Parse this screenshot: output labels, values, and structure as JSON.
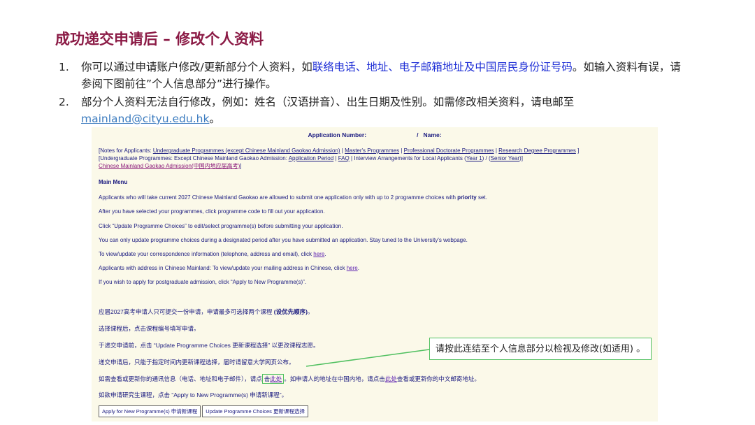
{
  "title": "成功递交申请后 – 修改个人资料",
  "points": [
    {
      "num": "1.",
      "pre": "你可以通过申请账户修改/更新部分个人资料，如",
      "hl1": "联络电话",
      "sep1": "、",
      "hl2": "地址",
      "sep2": "、",
      "hl3": "电子邮箱地址",
      "sep3": "及",
      "hl4": "中国居民身份证号码",
      "post": "。如输入资料有误，请参阅下图前往”个人信息部分”进行操作。"
    },
    {
      "num": "2.",
      "pre": "部分个人资料无法自行修改，例如：姓名（汉语拼音）、出生日期及性别。如需修改相关资料，请电邮至",
      "email": "mainland@cityu.edu.hk",
      "post": "。"
    }
  ],
  "shot": {
    "app_number_label": "Application Number:",
    "name_sep": "/",
    "name_label": "Name:",
    "notes": {
      "n1": "[Notes for Applicants:",
      "l1": "Undergraduate Programmes (except Chinese Mainland Gaokao Admission)",
      "s1": "|",
      "l2": "Master's Programmes",
      "s2": "|",
      "l3": "Professional Doctorate Programmes",
      "s3": "|",
      "l4": "Research Degree Programmes",
      "e1": "]",
      "n2": "[Undergraduate Programmes: Except Chinese Mainland Gaokao Admission:",
      "l5": "Application Period",
      "s5": "|",
      "l6": "FAQ",
      "t6": "| Interview Arrangements for Local Applicants (",
      "l7": "Year 1",
      "t7": ") / (",
      "l8": "Senior Year",
      "e2": ")]",
      "l9": "Chinese Mainland Gaokao Admission(中国内地应届高考)",
      "e3": "]"
    },
    "menu_title": "Main Menu",
    "en_lines": [
      {
        "pre": "Applicants who will take current 2027 Chinese Mainland Gaokao are allowed to submit one application only with up to 2 programme choices with ",
        "bold": "priority",
        "post": " set."
      },
      {
        "pre": "After you have selected your programmes, click programme code to fill out your application."
      },
      {
        "pre": "Click “Update Programme Choices” to edit/select programme(s) before submitting your application."
      },
      {
        "pre": "You can only update programme choices during a designated period after you have submitted an application. Stay tuned to the University's webpage."
      },
      {
        "pre": "To view/update your correspondence information (telephone, address and email), click ",
        "link": "here",
        "post": "."
      },
      {
        "pre": "Applicants with address in Chinese Mainland: To view/update your mailing address in Chinese, click ",
        "link": "here",
        "post": "."
      },
      {
        "pre": "If you wish to apply for postgraduate admission, click “Apply to New Programme(s)”."
      }
    ],
    "cn_lines": [
      {
        "pre": "应届2027高考申请人只可提交一份申请，申请最多可选择两个课程 ",
        "bold": "(设优先顺序)",
        "post": "。"
      },
      {
        "pre": "选择课程后，点击课程编号填写申请。"
      },
      {
        "pre": "于递交申请前，点击 “Update Programme Choices 更新课程选择” 以更改课程志愿。"
      },
      {
        "pre": "递交申请后，只能于指定时间内更新课程选择，届时请留意大学网页公布。"
      }
    ],
    "cn_info": {
      "pre": "如需查看或更新你的通讯信息（电话、地址和电子邮件），请点",
      "box_pre": "击",
      "link1": "此处",
      "mid": "。如申请人的地址在中国内地，请点击",
      "link2": "此处",
      "post": "查看或更新你的中文邮寄地址。"
    },
    "cn_last": "如欲申请研究生课程，点击 “Apply to New Programme(s) 申请新课程”。",
    "btn_apply": "Apply for New Programme(s) 申请新课程",
    "btn_update": "Update Programme Choices 更新课程选择"
  },
  "callout": "请按此连结至个人信息部分以检视及修改(如适用) 。",
  "colors": {
    "title": "#8b1a45",
    "highlight": "#1f2fd6",
    "callout_border": "#50c060",
    "panel_bg": "#fbf9e9"
  }
}
